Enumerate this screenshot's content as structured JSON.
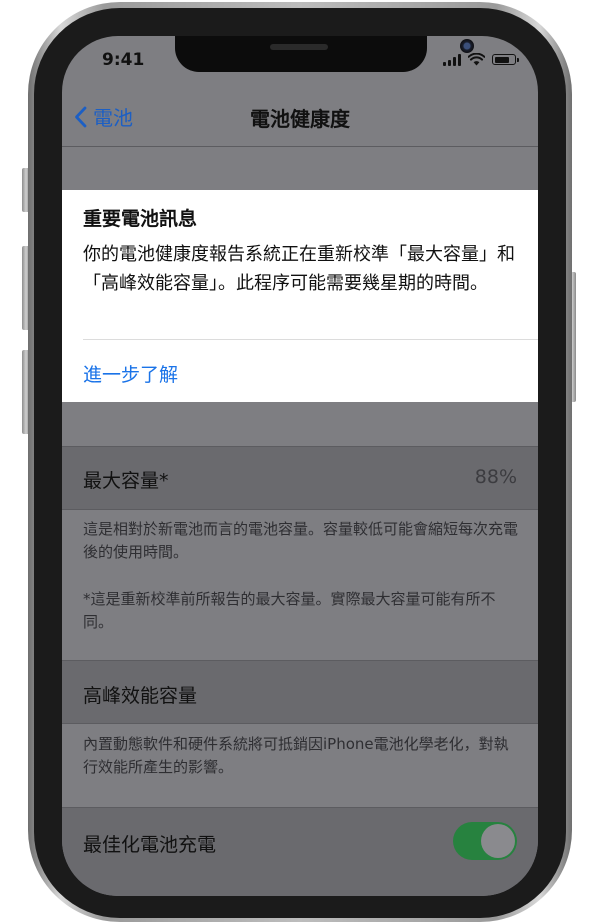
{
  "status_bar": {
    "time": "9:41",
    "battery_level": 0.8,
    "icons": [
      "signal-icon",
      "wifi-icon",
      "battery-icon"
    ]
  },
  "nav": {
    "back_label": "電池",
    "title": "電池健康度"
  },
  "info_card": {
    "title": "重要電池訊息",
    "body": "你的電池健康度報告系統正在重新校準「最大容量」和「高峰效能容量」。此程序可能需要幾星期的時間。",
    "link_label": "進一步了解"
  },
  "max_capacity": {
    "label": "最大容量*",
    "value": "88%",
    "footnote_1": "這是相對於新電池而言的電池容量。容量較低可能會縮短每次充電後的使用時間。",
    "footnote_2": "*這是重新校準前所報告的最大容量。實際最大容量可能有所不同。"
  },
  "peak_performance": {
    "label": "高峰效能容量",
    "footnote": "內置動態軟件和硬件系統將可抵銷因iPhone電池化學老化，對執行效能所產生的影響。"
  },
  "optimized_charging": {
    "label": "最佳化電池充電",
    "enabled": true
  },
  "colors": {
    "link": "#1a73e8",
    "toggle_on": "#27823f",
    "dim_background": "#7e7e82"
  }
}
